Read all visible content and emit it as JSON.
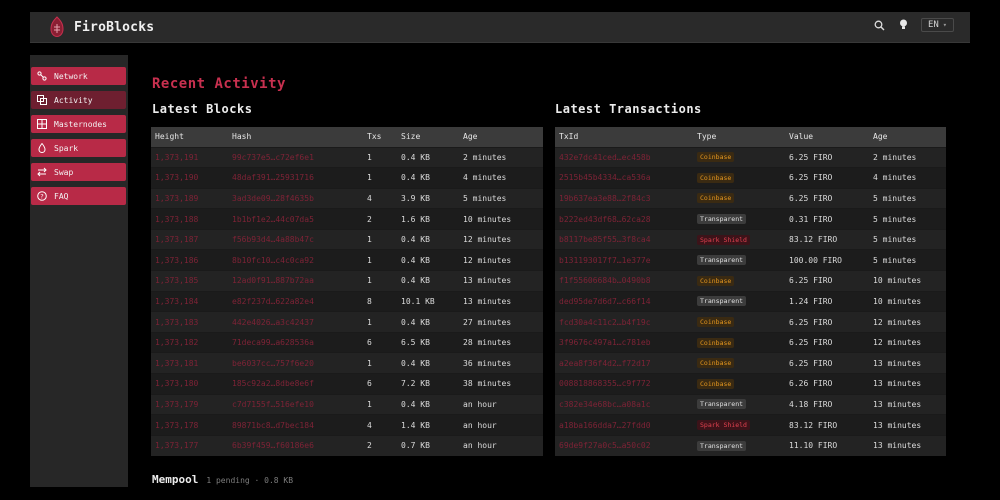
{
  "brand": {
    "name": "FiroBlocks"
  },
  "header": {
    "language": "EN"
  },
  "sidebar": {
    "items": [
      {
        "label": "Network",
        "icon": "network-icon",
        "active": false
      },
      {
        "label": "Activity",
        "icon": "activity-icon",
        "active": true
      },
      {
        "label": "Masternodes",
        "icon": "masternodes-icon",
        "active": false
      },
      {
        "label": "Spark",
        "icon": "spark-icon",
        "active": false
      },
      {
        "label": "Swap",
        "icon": "swap-icon",
        "active": false
      },
      {
        "label": "FAQ",
        "icon": "help-icon",
        "active": false
      }
    ]
  },
  "page": {
    "title": "Recent Activity"
  },
  "blocks": {
    "title": "Latest Blocks",
    "headers": [
      "Height",
      "Hash",
      "Txs",
      "Size",
      "Age"
    ],
    "rows": [
      [
        "1,373,191",
        "99c737e5…c72ef6e1",
        "1",
        "0.4 KB",
        "2 minutes"
      ],
      [
        "1,373,190",
        "48daf391…25931716",
        "1",
        "0.4 KB",
        "4 minutes"
      ],
      [
        "1,373,189",
        "3ad3de09…28f4635b",
        "4",
        "3.9 KB",
        "5 minutes"
      ],
      [
        "1,373,188",
        "1b1bf1e2…44c07da5",
        "2",
        "1.6 KB",
        "10 minutes"
      ],
      [
        "1,373,187",
        "f56b93d4…4a88b47c",
        "1",
        "0.4 KB",
        "12 minutes"
      ],
      [
        "1,373,186",
        "8b10fc10…c4c0ca92",
        "1",
        "0.4 KB",
        "12 minutes"
      ],
      [
        "1,373,185",
        "12ad0f91…887b72aa",
        "1",
        "0.4 KB",
        "13 minutes"
      ],
      [
        "1,373,184",
        "e82f237d…622a82e4",
        "8",
        "10.1 KB",
        "13 minutes"
      ],
      [
        "1,373,183",
        "442e4026…a3c42437",
        "1",
        "0.4 KB",
        "27 minutes"
      ],
      [
        "1,373,182",
        "71deca99…a628536a",
        "6",
        "6.5 KB",
        "28 minutes"
      ],
      [
        "1,373,181",
        "be6037cc…757f6e20",
        "1",
        "0.4 KB",
        "36 minutes"
      ],
      [
        "1,373,180",
        "185c92a2…8dbe8e6f",
        "6",
        "7.2 KB",
        "38 minutes"
      ],
      [
        "1,373,179",
        "c7d7155f…516efe10",
        "1",
        "0.4 KB",
        "an hour"
      ],
      [
        "1,373,178",
        "89871bc8…d7bec184",
        "4",
        "1.4 KB",
        "an hour"
      ],
      [
        "1,373,177",
        "6b39f459…f60186e6",
        "2",
        "0.7 KB",
        "an hour"
      ]
    ]
  },
  "transactions": {
    "title": "Latest Transactions",
    "headers": [
      "TxId",
      "Type",
      "Value",
      "Age"
    ],
    "rows": [
      [
        "432e7dc41ced…ec458b",
        "Coinbase",
        "6.25 FIRO",
        "2 minutes"
      ],
      [
        "2515b45b4334…ca536a",
        "Coinbase",
        "6.25 FIRO",
        "4 minutes"
      ],
      [
        "19b637ea3e88…2f84c3",
        "Coinbase",
        "6.25 FIRO",
        "5 minutes"
      ],
      [
        "b222ed43df68…62ca28",
        "Transparent",
        "0.31 FIRO",
        "5 minutes"
      ],
      [
        "b8117be85f55…3f8ca4",
        "Spark Shield",
        "83.12 FIRO",
        "5 minutes"
      ],
      [
        "b131193017f7…1e377e",
        "Transparent",
        "100.00 FIRO",
        "5 minutes"
      ],
      [
        "f1f55606684b…0490b8",
        "Coinbase",
        "6.25 FIRO",
        "10 minutes"
      ],
      [
        "ded95de7d6d7…c66f14",
        "Transparent",
        "1.24 FIRO",
        "10 minutes"
      ],
      [
        "fcd30a4c11c2…b4f19c",
        "Coinbase",
        "6.25 FIRO",
        "12 minutes"
      ],
      [
        "3f9676c497a1…c781eb",
        "Coinbase",
        "6.25 FIRO",
        "12 minutes"
      ],
      [
        "a2ea8f36f4d2…f72d17",
        "Coinbase",
        "6.25 FIRO",
        "13 minutes"
      ],
      [
        "008818868355…c9f772",
        "Coinbase",
        "6.26 FIRO",
        "13 minutes"
      ],
      [
        "c382e34e68bc…a08a1c",
        "Transparent",
        "4.18 FIRO",
        "13 minutes"
      ],
      [
        "a18ba166dda7…27fdd0",
        "Spark Shield",
        "83.12 FIRO",
        "13 minutes"
      ],
      [
        "69de9f27a0c5…a50c02",
        "Transparent",
        "11.10 FIRO",
        "13 minutes"
      ]
    ]
  },
  "mempool": {
    "title": "Mempool",
    "subtitle": "1 pending · 0.8 KB"
  },
  "colors": {
    "accent": "#b82a47",
    "accent_active": "#6e1f30",
    "link": "#7e2336",
    "coinbase": "#e3961f",
    "spark": "#e0414f"
  }
}
